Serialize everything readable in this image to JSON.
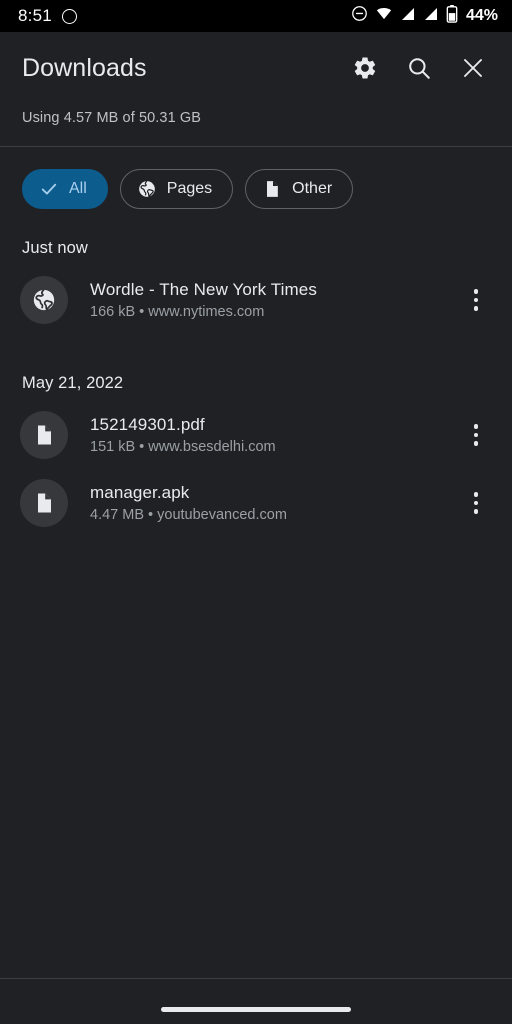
{
  "status_bar": {
    "time": "8:51",
    "battery_percent": "44%",
    "icons": [
      "notification-circle-icon",
      "do-not-disturb-icon",
      "wifi-icon",
      "signal-icon",
      "signal-icon",
      "battery-icon"
    ]
  },
  "header": {
    "title": "Downloads",
    "settings_label": "Settings",
    "search_label": "Search",
    "close_label": "Close"
  },
  "storage": {
    "text": "Using 4.57 MB of 50.31 GB"
  },
  "filters": {
    "chips": [
      {
        "label": "All",
        "icon": "check-icon",
        "selected": true
      },
      {
        "label": "Pages",
        "icon": "globe-icon",
        "selected": false
      },
      {
        "label": "Other",
        "icon": "file-icon",
        "selected": false
      }
    ],
    "selected_color": "#0d5c8e",
    "selected_text_color": "#a8cfee"
  },
  "sections": [
    {
      "header": "Just now",
      "items": [
        {
          "title": "Wordle - The New York Times",
          "subtitle": "166 kB • www.nytimes.com",
          "size": "166 kB",
          "source": "www.nytimes.com",
          "icon": "globe-icon"
        }
      ]
    },
    {
      "header": "May 21, 2022",
      "items": [
        {
          "title": "152149301.pdf",
          "subtitle": "151 kB • www.bsesdelhi.com",
          "size": "151 kB",
          "source": "www.bsesdelhi.com",
          "icon": "file-icon"
        },
        {
          "title": "manager.apk",
          "subtitle": "4.47 MB • youtubevanced.com",
          "size": "4.47 MB",
          "source": "youtubevanced.com",
          "icon": "file-icon"
        }
      ]
    }
  ],
  "colors": {
    "background": "#202124",
    "surface_text": "#e8eaed",
    "secondary_text": "#9aa0a6",
    "divider": "#3c4043",
    "accent": "#0d5c8e"
  }
}
